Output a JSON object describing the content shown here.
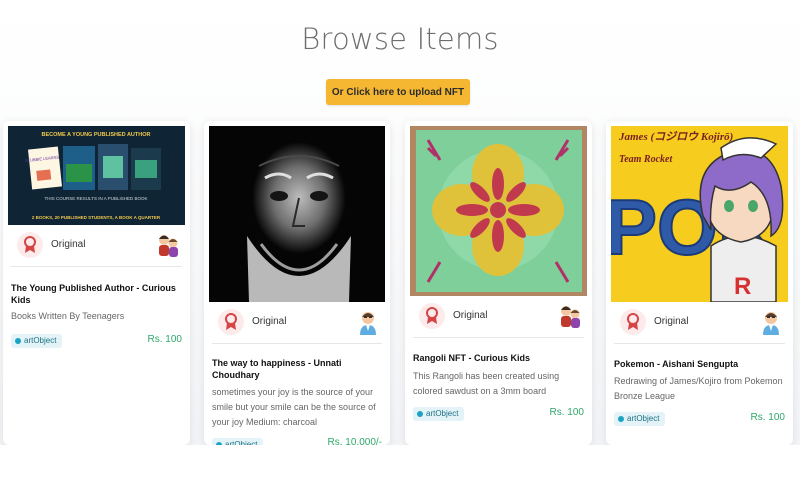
{
  "page": {
    "title": "Browse Items",
    "upload_label": "Or Click here to upload NFT"
  },
  "colors": {
    "accent": "#f5b731",
    "price": "#2fa86a",
    "tag_bg": "#e3f3f8",
    "tag_dot": "#1aa3c4"
  },
  "cover1": {
    "top": "BECOME A YOUNG PUBLISHED AUTHOR",
    "middle": "THIS COURSE RESULTS IN A PUBLISHED BOOK",
    "bottom": "2 BOOKS, 20 PUBLISHED STUDENTS, A BOOK A QUARTER",
    "book": "STUBBIE LEARNS"
  },
  "cover4": {
    "line1": "James (コジロウ Kojirō)",
    "line2": "Team Rocket",
    "letter": "R",
    "logo": "POK"
  },
  "cards": [
    {
      "meta_label": "Original",
      "title": "The Young Published Author - Curious Kids",
      "desc": "Books Written By Teenagers",
      "tag": "artObject",
      "price": "Rs. 100"
    },
    {
      "meta_label": "Original",
      "title": "The way to happiness - Unnati Choudhary",
      "desc": "sometimes your joy is the source of your smile but your smile can be the source of your joy Medium: charcoal",
      "tag": "artObject",
      "price": "Rs. 10,000/-"
    },
    {
      "meta_label": "Original",
      "title": "Rangoli NFT - Curious Kids",
      "desc": "This Rangoli has been created using colored sawdust on a 3mm board",
      "tag": "artObject",
      "price": "Rs. 100"
    },
    {
      "meta_label": "Original",
      "title": "Pokemon - Aishani Sengupta",
      "desc": "Redrawing of James/Kojiro from Pokemon Bronze League",
      "tag": "artObject",
      "price": "Rs. 100"
    }
  ]
}
